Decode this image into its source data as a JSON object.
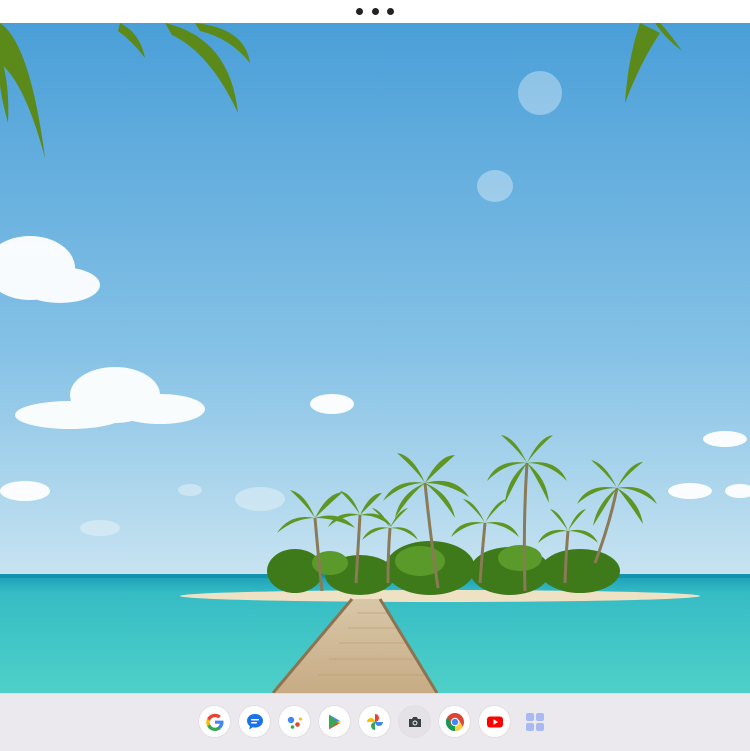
{
  "window": {
    "menu_icon": "three-dots-icon"
  },
  "wallpaper": {
    "description_icon": "tropical-island-wallpaper",
    "colors": {
      "sky_top": "#4a9fd8",
      "sky_bottom": "#c7e3f1",
      "sea": "#3cc4c6",
      "sand": "#efe2c4",
      "palm": "#4f8a1c"
    }
  },
  "shelf": {
    "background": "#ebe8ee",
    "apps": [
      {
        "name": "google-icon"
      },
      {
        "name": "messages-icon"
      },
      {
        "name": "assistant-icon"
      },
      {
        "name": "play-store-icon"
      },
      {
        "name": "photos-icon"
      },
      {
        "name": "camera-icon"
      },
      {
        "name": "chrome-icon"
      },
      {
        "name": "youtube-icon"
      },
      {
        "name": "launcher-icon"
      }
    ]
  }
}
